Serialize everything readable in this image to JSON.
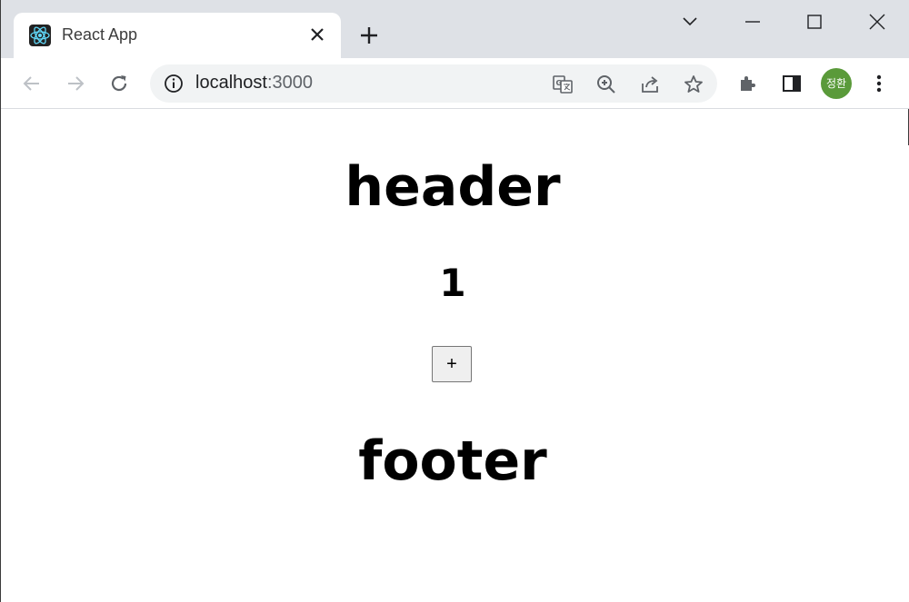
{
  "browser": {
    "tab_title": "React App",
    "url_host": "localhost",
    "url_port": ":3000",
    "profile_initials": "정환",
    "colors": {
      "tabstrip": "#dee1e6",
      "avatar": "#5a9a3a",
      "react": "#61dafb"
    }
  },
  "page": {
    "header": "header",
    "count": "1",
    "increment_label": "+",
    "footer": "footer"
  }
}
